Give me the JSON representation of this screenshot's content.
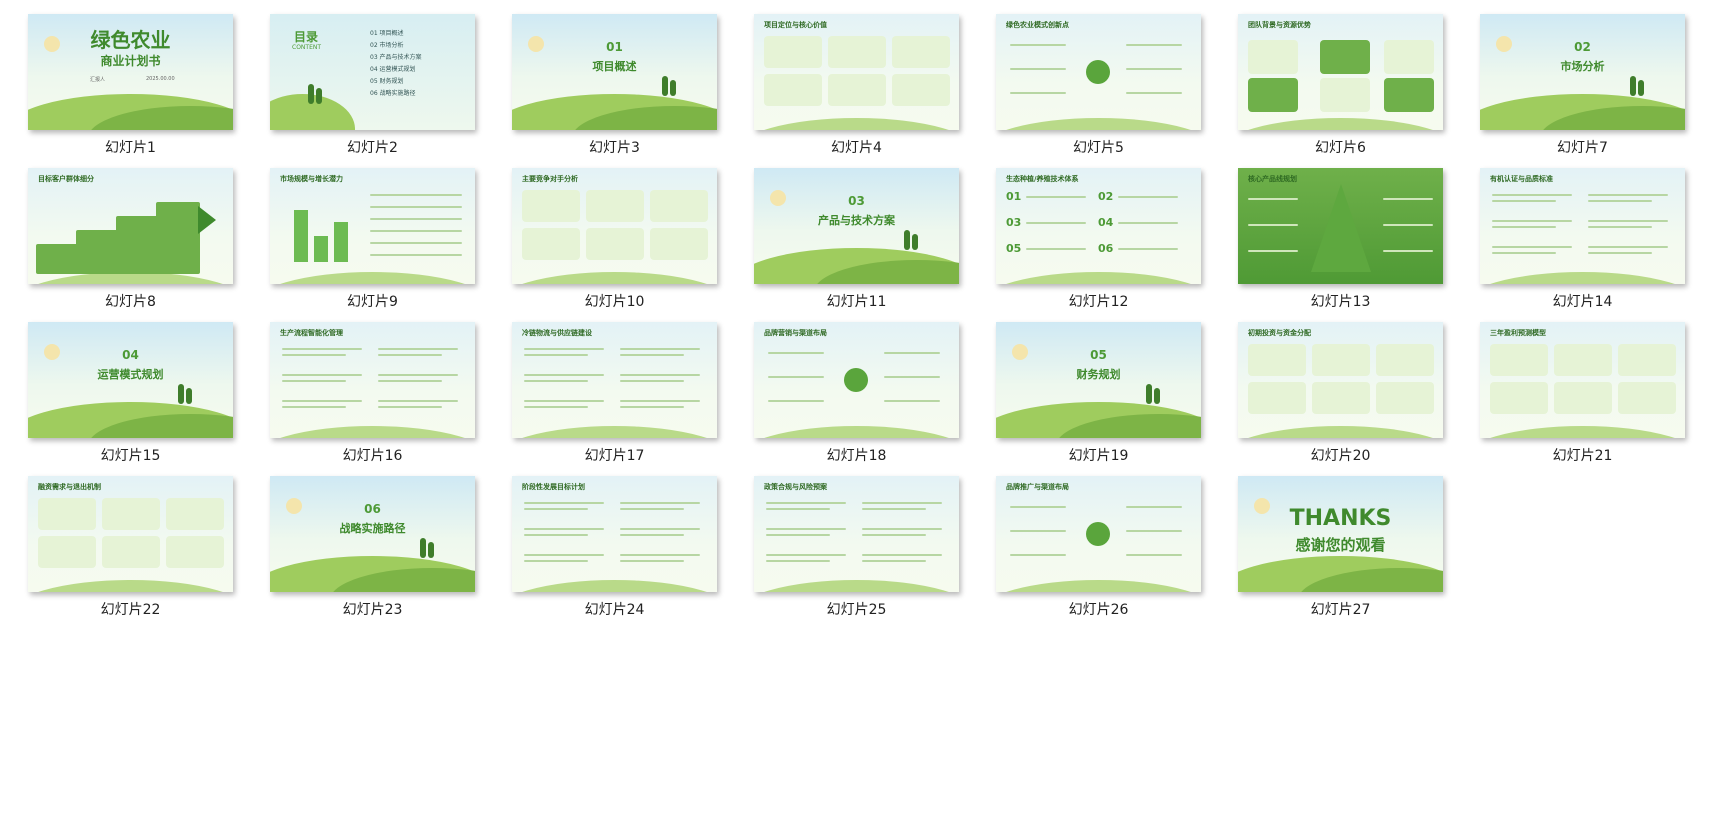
{
  "slides": [
    {
      "label": "幻灯片1",
      "kind": "cover",
      "title": "绿色农业",
      "subtitle": "商业计划书",
      "meta_left": "汇报人",
      "meta_right": "2025.00.00"
    },
    {
      "label": "幻灯片2",
      "kind": "contents",
      "heading": "目录",
      "heading_en": "CONTENT",
      "items": [
        "01  项目概述",
        "02  市场分析",
        "03  产品与技术方案",
        "04  运营模式规划",
        "05  财务规划",
        "06  战略实施路径"
      ]
    },
    {
      "label": "幻灯片3",
      "kind": "section",
      "num": "01",
      "title": "项目概述"
    },
    {
      "label": "幻灯片4",
      "kind": "cards6",
      "heading": "项目定位与核心价值"
    },
    {
      "label": "幻灯片5",
      "kind": "hub",
      "heading": "绿色农业模式创新点"
    },
    {
      "label": "幻灯片6",
      "kind": "team",
      "heading": "团队背景与资源优势"
    },
    {
      "label": "幻灯片7",
      "kind": "section",
      "num": "02",
      "title": "市场分析"
    },
    {
      "label": "幻灯片8",
      "kind": "steps",
      "heading": "目标客户群体细分"
    },
    {
      "label": "幻灯片9",
      "kind": "bars",
      "heading": "市场规模与增长潜力"
    },
    {
      "label": "幻灯片10",
      "kind": "cards6",
      "heading": "主要竞争对手分析"
    },
    {
      "label": "幻灯片11",
      "kind": "section",
      "num": "03",
      "title": "产品与技术方案"
    },
    {
      "label": "幻灯片12",
      "kind": "numbered",
      "heading": "生态种植/养殖技术体系",
      "nums": [
        "01",
        "02",
        "03",
        "04",
        "05",
        "06"
      ]
    },
    {
      "label": "幻灯片13",
      "kind": "pyramid",
      "heading": "核心产品线规划"
    },
    {
      "label": "幻灯片14",
      "kind": "list6",
      "heading": "有机认证与品质标准"
    },
    {
      "label": "幻灯片15",
      "kind": "section",
      "num": "04",
      "title": "运营模式规划"
    },
    {
      "label": "幻灯片16",
      "kind": "list6",
      "heading": "生产流程智能化管理"
    },
    {
      "label": "幻灯片17",
      "kind": "list6",
      "heading": "冷链物流与供应链建设"
    },
    {
      "label": "幻灯片18",
      "kind": "hub",
      "heading": "品牌营销与渠道布局"
    },
    {
      "label": "幻灯片19",
      "kind": "section",
      "num": "05",
      "title": "财务规划"
    },
    {
      "label": "幻灯片20",
      "kind": "cards6",
      "heading": "初期投资与资金分配"
    },
    {
      "label": "幻灯片21",
      "kind": "cards6",
      "heading": "三年盈利预测模型"
    },
    {
      "label": "幻灯片22",
      "kind": "cards6",
      "heading": "融资需求与退出机制"
    },
    {
      "label": "幻灯片23",
      "kind": "section",
      "num": "06",
      "title": "战略实施路径"
    },
    {
      "label": "幻灯片24",
      "kind": "list6",
      "heading": "阶段性发展目标计划"
    },
    {
      "label": "幻灯片25",
      "kind": "list6",
      "heading": "政策合规与风险预案"
    },
    {
      "label": "幻灯片26",
      "kind": "hub",
      "heading": "品牌推广与渠道布局"
    },
    {
      "label": "幻灯片27",
      "kind": "thanks",
      "title": "THANKS",
      "subtitle": "感谢您的观看"
    }
  ],
  "colors": {
    "accent": "#4d9a36",
    "accent_dark": "#2f6a23",
    "card": "#e6f3d6",
    "sky": "#cfe9f4"
  }
}
